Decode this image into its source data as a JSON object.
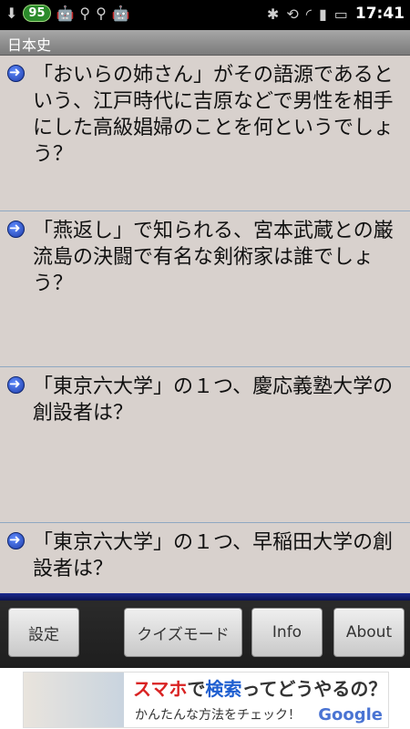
{
  "status_bar": {
    "badge": "95",
    "time": "17:41",
    "icons": [
      "download-icon",
      "android-icon",
      "usb-icon",
      "usb-icon",
      "android-icon",
      "bluetooth-icon",
      "rotate-icon",
      "wifi-icon",
      "signal-icon",
      "battery-icon"
    ]
  },
  "title": "日本史",
  "list": {
    "items": [
      {
        "text": "「おいらの姉さん」がその語源であるという、江戸時代に吉原などで男性を相手にした高級娼婦のことを何というでしょう？"
      },
      {
        "text": "「燕返し」で知られる、宮本武蔵との巌流島の決闘で有名な剣術家は誰でしょう？"
      },
      {
        "text": "「東京六大学」の１つ、慶応義塾大学の創設者は？"
      },
      {
        "text": "「東京六大学」の１つ、早稲田大学の創設者は？"
      }
    ]
  },
  "buttons": {
    "settings": "設定",
    "quiz_mode": "クイズモード",
    "info": "Info",
    "about": "About"
  },
  "ad": {
    "headline_red": "スマホ",
    "headline_mid": "で",
    "headline_blue": "検索",
    "headline_end": "ってどうやるの？",
    "sub": "かんたんな方法をチェック！",
    "logo": "Google"
  }
}
